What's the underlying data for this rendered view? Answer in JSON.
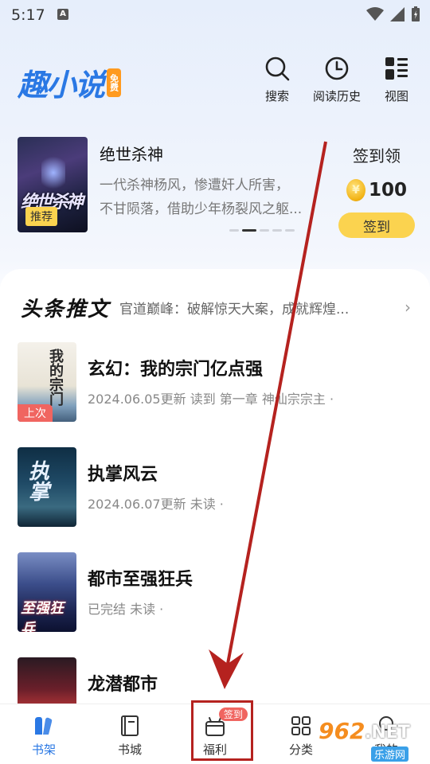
{
  "status_bar": {
    "time": "5:17",
    "notification_letter": "A"
  },
  "header": {
    "logo": "趣小说",
    "logo_badge": "免费",
    "actions": [
      {
        "label": "搜索",
        "icon": "search-icon"
      },
      {
        "label": "阅读历史",
        "icon": "clock-icon"
      },
      {
        "label": "视图",
        "icon": "grid-view-icon"
      }
    ]
  },
  "banner": {
    "title": "绝世杀神",
    "desc_line1": "一代杀神杨风，惨遭奸人所害，",
    "desc_line2": "不甘陨落，借助少年杨裂风之躯...",
    "cover_title": "绝世杀神",
    "cover_tag": "推荐",
    "carousel_pages": 5,
    "carousel_active": 2
  },
  "signin": {
    "title": "签到领",
    "coin_amount": "100",
    "button": "签到"
  },
  "section": {
    "title": "头条推文",
    "ticker": "官道巅峰：破解惊天大案，成就辉煌...",
    "arrow": "›"
  },
  "books": [
    {
      "title": "玄幻：我的宗门亿点强",
      "meta": "2024.06.05更新 读到 第一章 神仙宗宗主 ·",
      "tag": "上次"
    },
    {
      "title": "执掌风云",
      "meta": "2024.06.07更新 未读 ·",
      "tag": ""
    },
    {
      "title": "都市至强狂兵",
      "meta": "已完结 未读 ·",
      "tag": ""
    },
    {
      "title": "龙潜都市",
      "meta": "",
      "tag": ""
    }
  ],
  "tabbar": {
    "tabs": [
      {
        "label": "书架",
        "icon": "bookshelf-icon",
        "active": true
      },
      {
        "label": "书城",
        "icon": "book-icon",
        "active": false
      },
      {
        "label": "福利",
        "icon": "gift-icon",
        "active": false,
        "badge": "签到"
      },
      {
        "label": "分类",
        "icon": "category-icon",
        "active": false
      },
      {
        "label": "我的",
        "icon": "profile-icon",
        "active": false
      }
    ]
  },
  "watermark": {
    "number": "962",
    "suffix": ".NET",
    "site": "乐游网"
  },
  "colors": {
    "accent": "#2a78e4",
    "signin_yellow": "#fbd34f",
    "annotation_red": "#b5221f",
    "tag_red": "#f06560"
  }
}
